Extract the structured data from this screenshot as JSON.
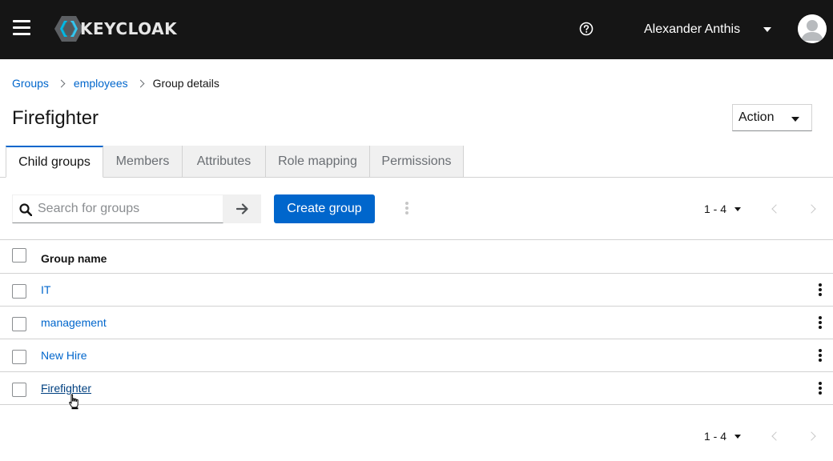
{
  "colors": {
    "header_bg": "#151515",
    "link": "#0066cc",
    "primary": "#0066cc",
    "border": "#d2d2d2"
  },
  "header": {
    "menu_icon": "hamburger-icon",
    "logo_text": "KEYCLOAK",
    "help_icon": "help-circle-icon",
    "user_name": "Alexander Anthis",
    "avatar_icon": "user-avatar-icon"
  },
  "breadcrumb": [
    {
      "label": "Groups",
      "link": true
    },
    {
      "label": "employees",
      "link": true
    },
    {
      "label": "Group details",
      "link": false
    }
  ],
  "page": {
    "title": "Firefighter",
    "action_label": "Action"
  },
  "tabs": [
    {
      "label": "Child groups",
      "active": true
    },
    {
      "label": "Members",
      "active": false
    },
    {
      "label": "Attributes",
      "active": false
    },
    {
      "label": "Role mapping",
      "active": false
    },
    {
      "label": "Permissions",
      "active": false
    }
  ],
  "toolbar": {
    "search_placeholder": "Search for groups",
    "search_value": "",
    "create_label": "Create group",
    "pagination_top": "1 - 4"
  },
  "table": {
    "column_header": "Group name",
    "rows": [
      {
        "name": "IT"
      },
      {
        "name": "management"
      },
      {
        "name": "New Hire"
      },
      {
        "name": "Firefighter"
      }
    ]
  },
  "pagination_bottom": "1 - 4"
}
